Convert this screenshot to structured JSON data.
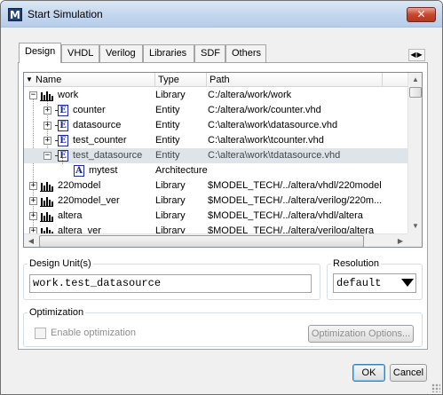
{
  "window": {
    "title": "Start Simulation",
    "app_icon_letter": "M",
    "close_symbol": "✕"
  },
  "tabs": [
    {
      "label": "Design",
      "active": true
    },
    {
      "label": "VHDL",
      "active": false
    },
    {
      "label": "Verilog",
      "active": false
    },
    {
      "label": "Libraries",
      "active": false
    },
    {
      "label": "SDF",
      "active": false
    },
    {
      "label": "Others",
      "active": false
    }
  ],
  "tree": {
    "columns": [
      "Name",
      "Type",
      "Path"
    ],
    "rows": [
      {
        "icon": "library",
        "expander": "minus",
        "name": "work",
        "type": "Library",
        "path": "C:/altera/work/work",
        "selected": false
      },
      {
        "icon": "entity",
        "expander": "plus",
        "name": "counter",
        "type": "Entity",
        "path": "C:/altera/work/counter.vhd",
        "selected": false
      },
      {
        "icon": "entity",
        "expander": "plus",
        "name": "datasource",
        "type": "Entity",
        "path": "C:\\altera\\work\\datasource.vhd",
        "selected": false
      },
      {
        "icon": "entity",
        "expander": "plus",
        "name": "test_counter",
        "type": "Entity",
        "path": "C:\\altera\\work\\tcounter.vhd",
        "selected": false
      },
      {
        "icon": "entity",
        "expander": "minus",
        "name": "test_datasource",
        "type": "Entity",
        "path": "C:\\altera\\work\\tdatasource.vhd",
        "selected": true
      },
      {
        "icon": "architecture",
        "expander": "",
        "name": "mytest",
        "type": "Architecture",
        "path": "",
        "selected": false
      },
      {
        "icon": "library",
        "expander": "plus",
        "name": "220model",
        "type": "Library",
        "path": "$MODEL_TECH/../altera/vhdl/220model",
        "selected": false
      },
      {
        "icon": "library",
        "expander": "plus",
        "name": "220model_ver",
        "type": "Library",
        "path": "$MODEL_TECH/../altera/verilog/220m...",
        "selected": false
      },
      {
        "icon": "library",
        "expander": "plus",
        "name": "altera",
        "type": "Library",
        "path": "$MODEL_TECH/../altera/vhdl/altera",
        "selected": false
      },
      {
        "icon": "library",
        "expander": "plus",
        "name": "altera_ver",
        "type": "Library",
        "path": "$MODEL_TECH/../altera/verilog/altera",
        "selected": false
      }
    ]
  },
  "design_units": {
    "legend": "Design Unit(s)",
    "value": "work.test_datasource"
  },
  "resolution": {
    "legend": "Resolution",
    "selected": "default"
  },
  "optimization": {
    "legend": "Optimization",
    "enable_label": "Enable optimization",
    "enabled": false,
    "options_button": "Optimization Options..."
  },
  "buttons": {
    "ok": "OK",
    "cancel": "Cancel"
  },
  "icons": {
    "library": "library-icon",
    "entity": "entity-icon",
    "architecture": "architecture-icon"
  }
}
